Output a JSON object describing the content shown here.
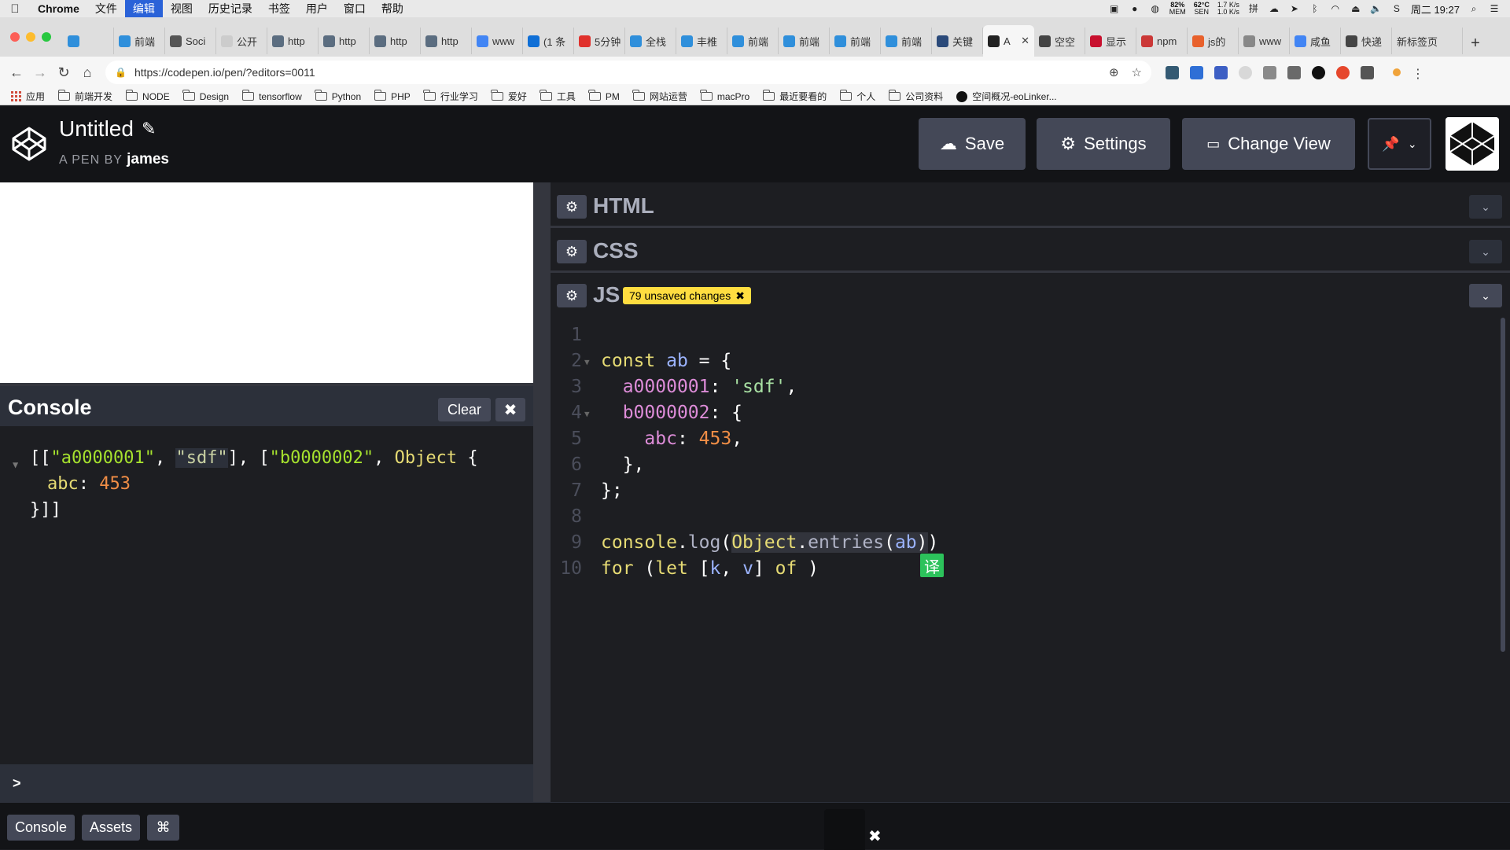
{
  "menubar": {
    "app": "Chrome",
    "items": [
      "文件",
      "编辑",
      "视图",
      "历史记录",
      "书签",
      "用户",
      "窗口",
      "帮助"
    ],
    "active_index": 1,
    "stats": {
      "mem": "82%",
      "mem_label": "MEM",
      "temp": "62°C",
      "temp_label": "SEN",
      "net_up": "1.7 K/s",
      "net_down": "1.0 K/s"
    },
    "clock": "周二 19:27"
  },
  "tabs": [
    {
      "label": "",
      "color": "#2f8fdb"
    },
    {
      "label": "前端",
      "color": "#2f8fdb"
    },
    {
      "label": "Soci",
      "color": "#555555"
    },
    {
      "label": "公开",
      "color": "#cccccc"
    },
    {
      "label": "http",
      "color": "#5b6d80"
    },
    {
      "label": "http",
      "color": "#5b6d80"
    },
    {
      "label": "http",
      "color": "#5b6d80"
    },
    {
      "label": "http",
      "color": "#5b6d80"
    },
    {
      "label": "www",
      "color": "#4285f4"
    },
    {
      "label": "(1 条",
      "color": "#0f6fd6"
    },
    {
      "label": "5分钟",
      "color": "#e0312c"
    },
    {
      "label": "全栈",
      "color": "#2f8fdb"
    },
    {
      "label": "丰椎",
      "color": "#2f8fdb"
    },
    {
      "label": "前端",
      "color": "#2f8fdb"
    },
    {
      "label": "前端",
      "color": "#2f8fdb"
    },
    {
      "label": "前端",
      "color": "#2f8fdb"
    },
    {
      "label": "前端",
      "color": "#2f8fdb"
    },
    {
      "label": "关键",
      "color": "#2b4a7a"
    },
    {
      "label": "A",
      "color": "#222222",
      "active": true
    },
    {
      "label": "空空",
      "color": "#444444"
    },
    {
      "label": "显示",
      "color": "#c8102e"
    },
    {
      "label": "npm",
      "color": "#cb3837"
    },
    {
      "label": "js的",
      "color": "#e8612c"
    },
    {
      "label": "www",
      "color": "#888888"
    },
    {
      "label": "咸鱼",
      "color": "#4285f4"
    },
    {
      "label": "快递",
      "color": "#444444"
    },
    {
      "label": "新标签页",
      "color": ""
    }
  ],
  "address": {
    "url": "https://codepen.io/pen/?editors=0011"
  },
  "bookmarks": [
    "应用",
    "前端开发",
    "NODE",
    "Design",
    "tensorflow",
    "Python",
    "PHP",
    "行业学习",
    "爱好",
    "工具",
    "PM",
    "网站运营",
    "macPro",
    "最近要看的",
    "个人",
    "公司资料",
    "空间概况-eoLinker..."
  ],
  "header": {
    "title": "Untitled",
    "by_label": "A PEN BY",
    "author": "james",
    "save": "Save",
    "settings": "Settings",
    "change_view": "Change View"
  },
  "console": {
    "title": "Console",
    "clear": "Clear",
    "prompt": ">"
  },
  "editors": {
    "html": "HTML",
    "css": "CSS",
    "js": "JS",
    "badge": "79 unsaved changes"
  },
  "code_lines": [
    "1",
    "2",
    "3",
    "4",
    "5",
    "6",
    "7",
    "8",
    "9",
    "10"
  ],
  "translate_label": "译",
  "bottom": {
    "console": "Console",
    "assets": "Assets",
    "shortcuts": "⌘"
  }
}
